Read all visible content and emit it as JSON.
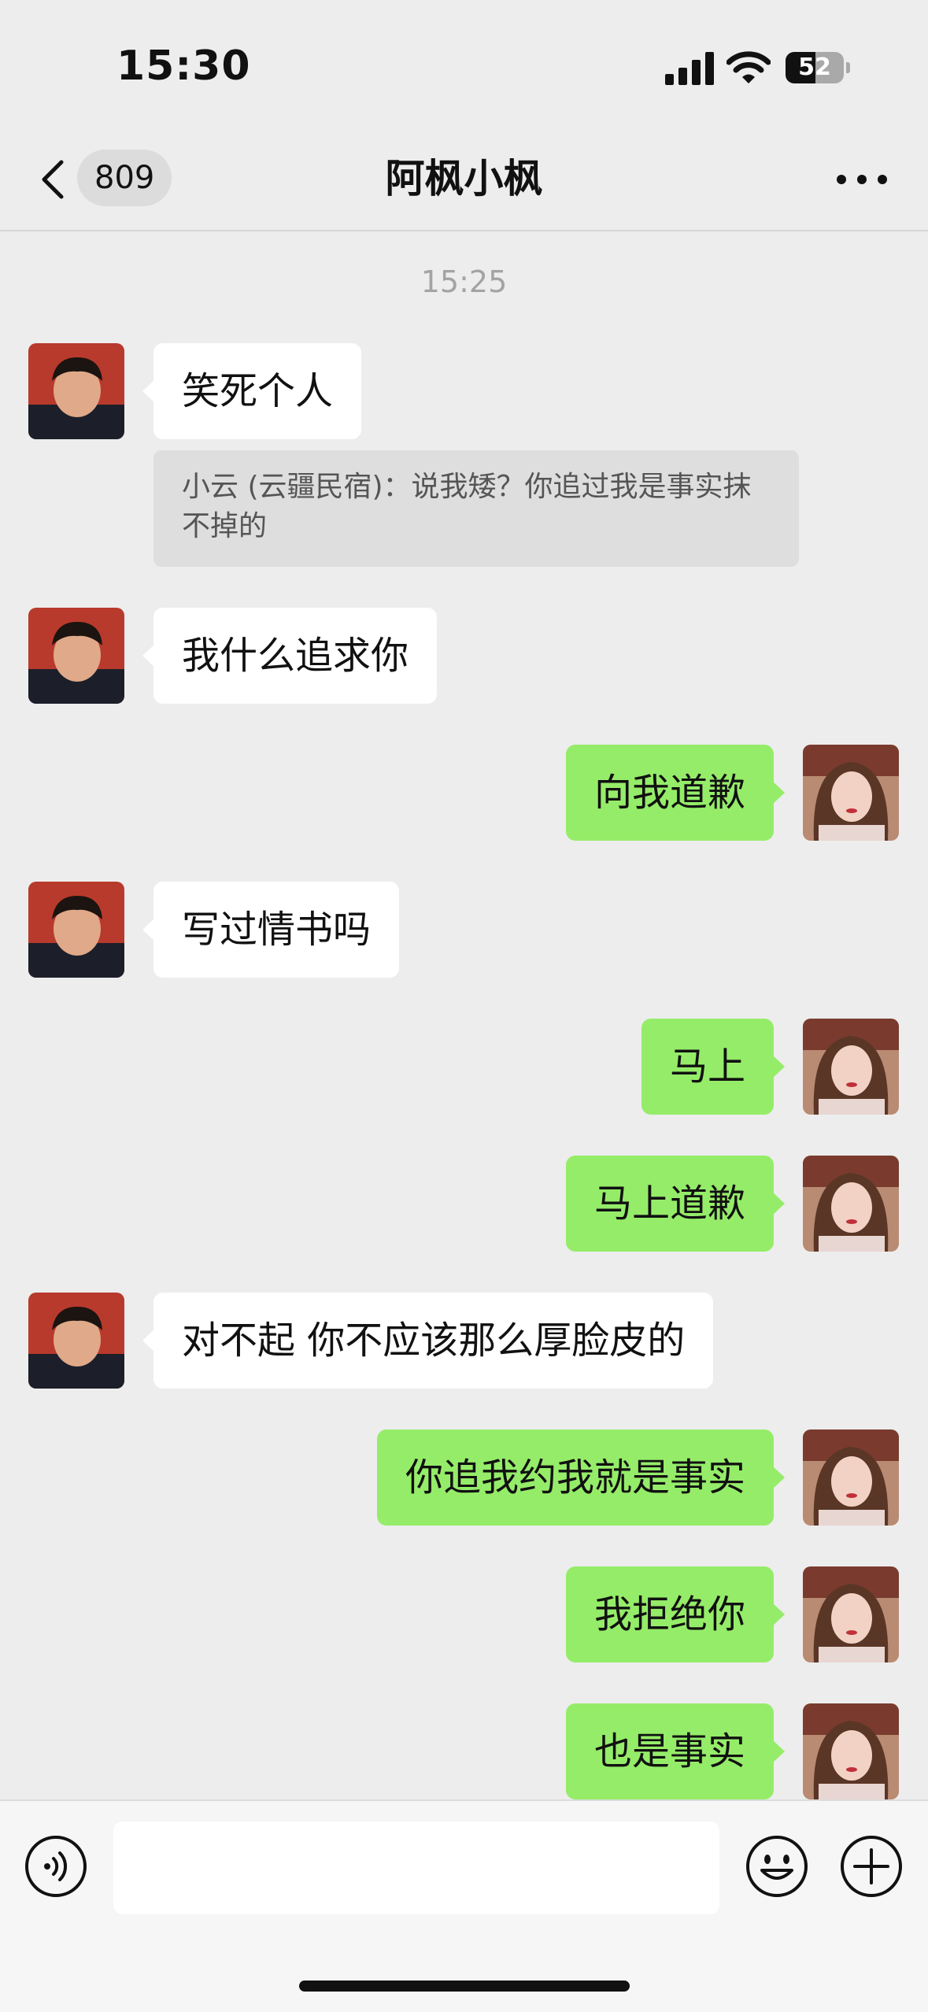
{
  "status_bar": {
    "time": "15:30",
    "battery": "52",
    "battery_level": 0.52
  },
  "nav": {
    "unread_count": "809",
    "title": "阿枫小枫"
  },
  "chat": {
    "timestamp": "15:25",
    "quote_text": "小云 (云疆民宿)：说我矮？你追过我是事实抹不掉的",
    "messages": [
      {
        "side": "left",
        "text": "笑死个人"
      },
      {
        "side": "left",
        "text": "我什么追求你"
      },
      {
        "side": "right",
        "text": "向我道歉"
      },
      {
        "side": "left",
        "text": "写过情书吗"
      },
      {
        "side": "right",
        "text": "马上"
      },
      {
        "side": "right",
        "text": "马上道歉"
      },
      {
        "side": "left",
        "text": "对不起 你不应该那么厚脸皮的"
      },
      {
        "side": "right",
        "text": "你追我约我就是事实"
      },
      {
        "side": "right",
        "text": "我拒绝你"
      },
      {
        "side": "right",
        "text": "也是事实"
      }
    ]
  },
  "input": {
    "value": "",
    "placeholder": ""
  },
  "icons": {
    "back": "chevron-left-icon",
    "more": "ellipsis-icon",
    "voice": "voice-icon",
    "emoji": "emoji-icon",
    "plus": "plus-icon"
  },
  "colors": {
    "background": "#ededed",
    "bubble_self": "#95ec69",
    "bubble_other": "#ffffff"
  }
}
